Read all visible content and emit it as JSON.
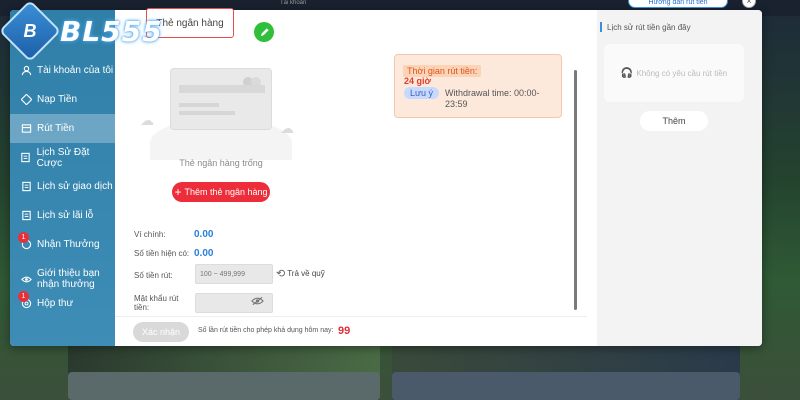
{
  "logo": {
    "text": "BL555",
    "badge": "B"
  },
  "top": {
    "guide_label": "Hướng dẫn rút tiền",
    "close": "×",
    "crumb": "Tài khoản"
  },
  "sidebar": {
    "items": [
      {
        "label": "Tài khoản của tôi",
        "icon": "user-icon",
        "active": false
      },
      {
        "label": "Nạp Tiền",
        "icon": "deposit-icon",
        "active": false
      },
      {
        "label": "Rút Tiền",
        "icon": "withdraw-icon",
        "active": true
      },
      {
        "label": "Lịch Sử Đặt Cược",
        "icon": "bet-history-icon",
        "active": false
      },
      {
        "label": "Lịch sử giao dịch",
        "icon": "transaction-icon",
        "active": false
      },
      {
        "label": "Lịch sử lãi lỗ",
        "icon": "profit-loss-icon",
        "active": false
      },
      {
        "label": "Nhận Thưởng",
        "icon": "gift-icon",
        "badge": "1",
        "active": false
      },
      {
        "label": "Giới thiệu bạn nhận thưởng",
        "icon": "refer-icon",
        "active": false
      },
      {
        "label": "Hộp thư",
        "icon": "mail-icon",
        "badge": "1",
        "active": false
      }
    ]
  },
  "main": {
    "bank_tab_label": "Thẻ ngân hàng",
    "card_empty_text": "Thẻ ngân hàng trống",
    "add_bank_label": "Thêm thẻ ngân hàng",
    "notice": {
      "time_title": "Thời gian rút tiền:",
      "hours": "24 giờ",
      "note_tag": "Lưu ý",
      "withdrawal_time": "Withdrawal time: 00:00-23:59"
    },
    "fields": {
      "main_wallet_label": "Ví chính:",
      "main_wallet_value": "0.00",
      "current_balance_label": "Số tiền hiện có:",
      "current_balance_value": "0.00",
      "amount_label": "Số tiền rút:",
      "amount_placeholder": "100 ~ 499,999",
      "refund_label": "Trả về quỹ",
      "password_label": "Mật khẩu rút tiền:",
      "password_placeholder": ""
    },
    "confirm_label": "Xác nhận",
    "remaining_text": "Số lần rút tiền cho phép khả dụng hôm nay:",
    "remaining_value": "99"
  },
  "right_panel": {
    "title": "Lịch sử rút tiền gần đây",
    "empty_text": "Không có yêu cầu rút tiền",
    "more_label": "Thêm"
  },
  "colors": {
    "sidebar": "#3e8db7",
    "accent_red": "#ee2d3b",
    "value_blue": "#2a7fd8",
    "edit_green": "#2fbf3a"
  }
}
